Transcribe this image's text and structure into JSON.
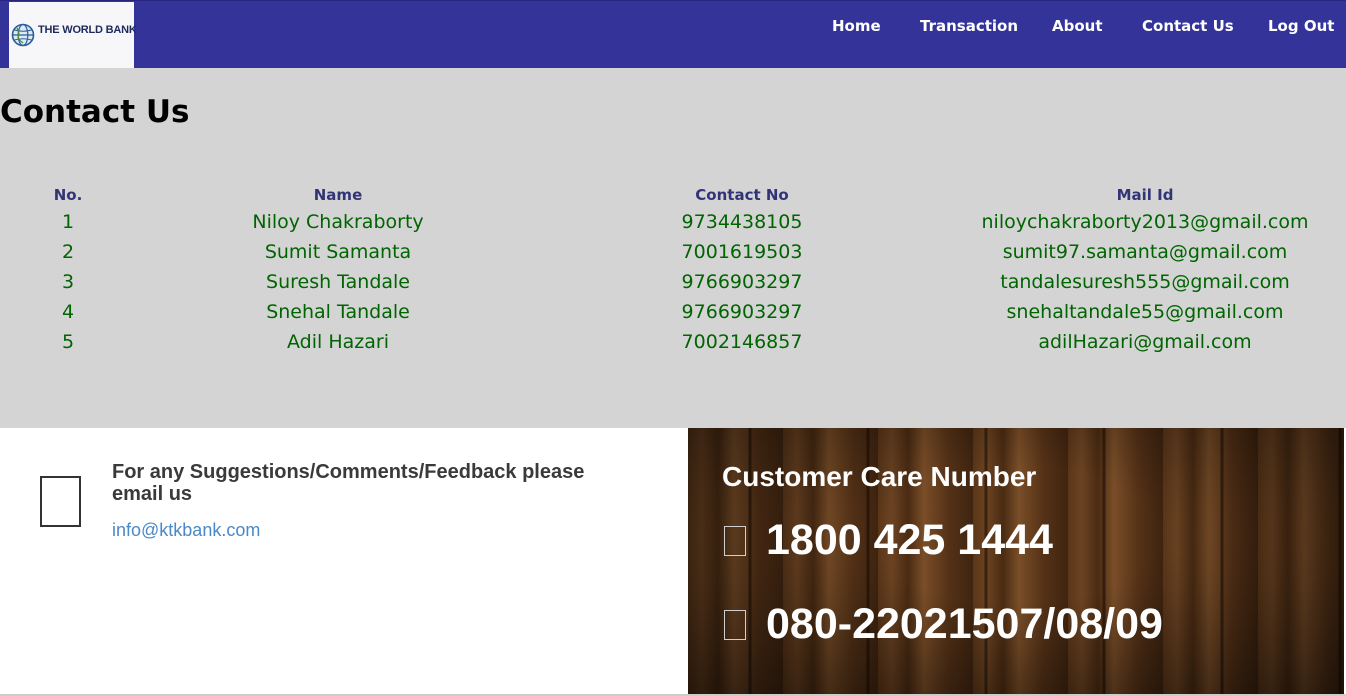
{
  "logo": {
    "text": "THE WORLD BANK",
    "icon": "globe-icon"
  },
  "nav": {
    "items": [
      {
        "label": "Home"
      },
      {
        "label": "Transaction"
      },
      {
        "label": "About"
      },
      {
        "label": "Contact Us"
      },
      {
        "label": "Log Out"
      }
    ]
  },
  "contact": {
    "title": "Contact Us",
    "headers": {
      "no": "No.",
      "name": "Name",
      "contact": "Contact No",
      "mail": "Mail Id"
    },
    "rows": [
      {
        "no": "1",
        "name": "Niloy Chakraborty",
        "contact": "9734438105",
        "mail": "niloychakraborty2013@gmail.com"
      },
      {
        "no": "2",
        "name": "Sumit Samanta",
        "contact": "7001619503",
        "mail": "sumit97.samanta@gmail.com"
      },
      {
        "no": "3",
        "name": "Suresh Tandale",
        "contact": "9766903297",
        "mail": "tandalesuresh555@gmail.com"
      },
      {
        "no": "4",
        "name": "Snehal Tandale",
        "contact": "9766903297",
        "mail": "snehaltandale55@gmail.com"
      },
      {
        "no": "5",
        "name": "Adil Hazari",
        "contact": "7002146857",
        "mail": "adilHazari@gmail.com"
      }
    ]
  },
  "footer": {
    "feedback_text": "For any Suggestions/Comments/Feedback please email us",
    "feedback_email": "info@ktkbank.com",
    "care_title": "Customer Care Number",
    "phone1": "1800 425 1444",
    "phone2": "080-22021507/08/09"
  },
  "colors": {
    "navbar": "#333399",
    "section_bg": "#d4d4d4",
    "header_text": "#333377",
    "row_text": "#006400",
    "link": "#4a88c9"
  }
}
